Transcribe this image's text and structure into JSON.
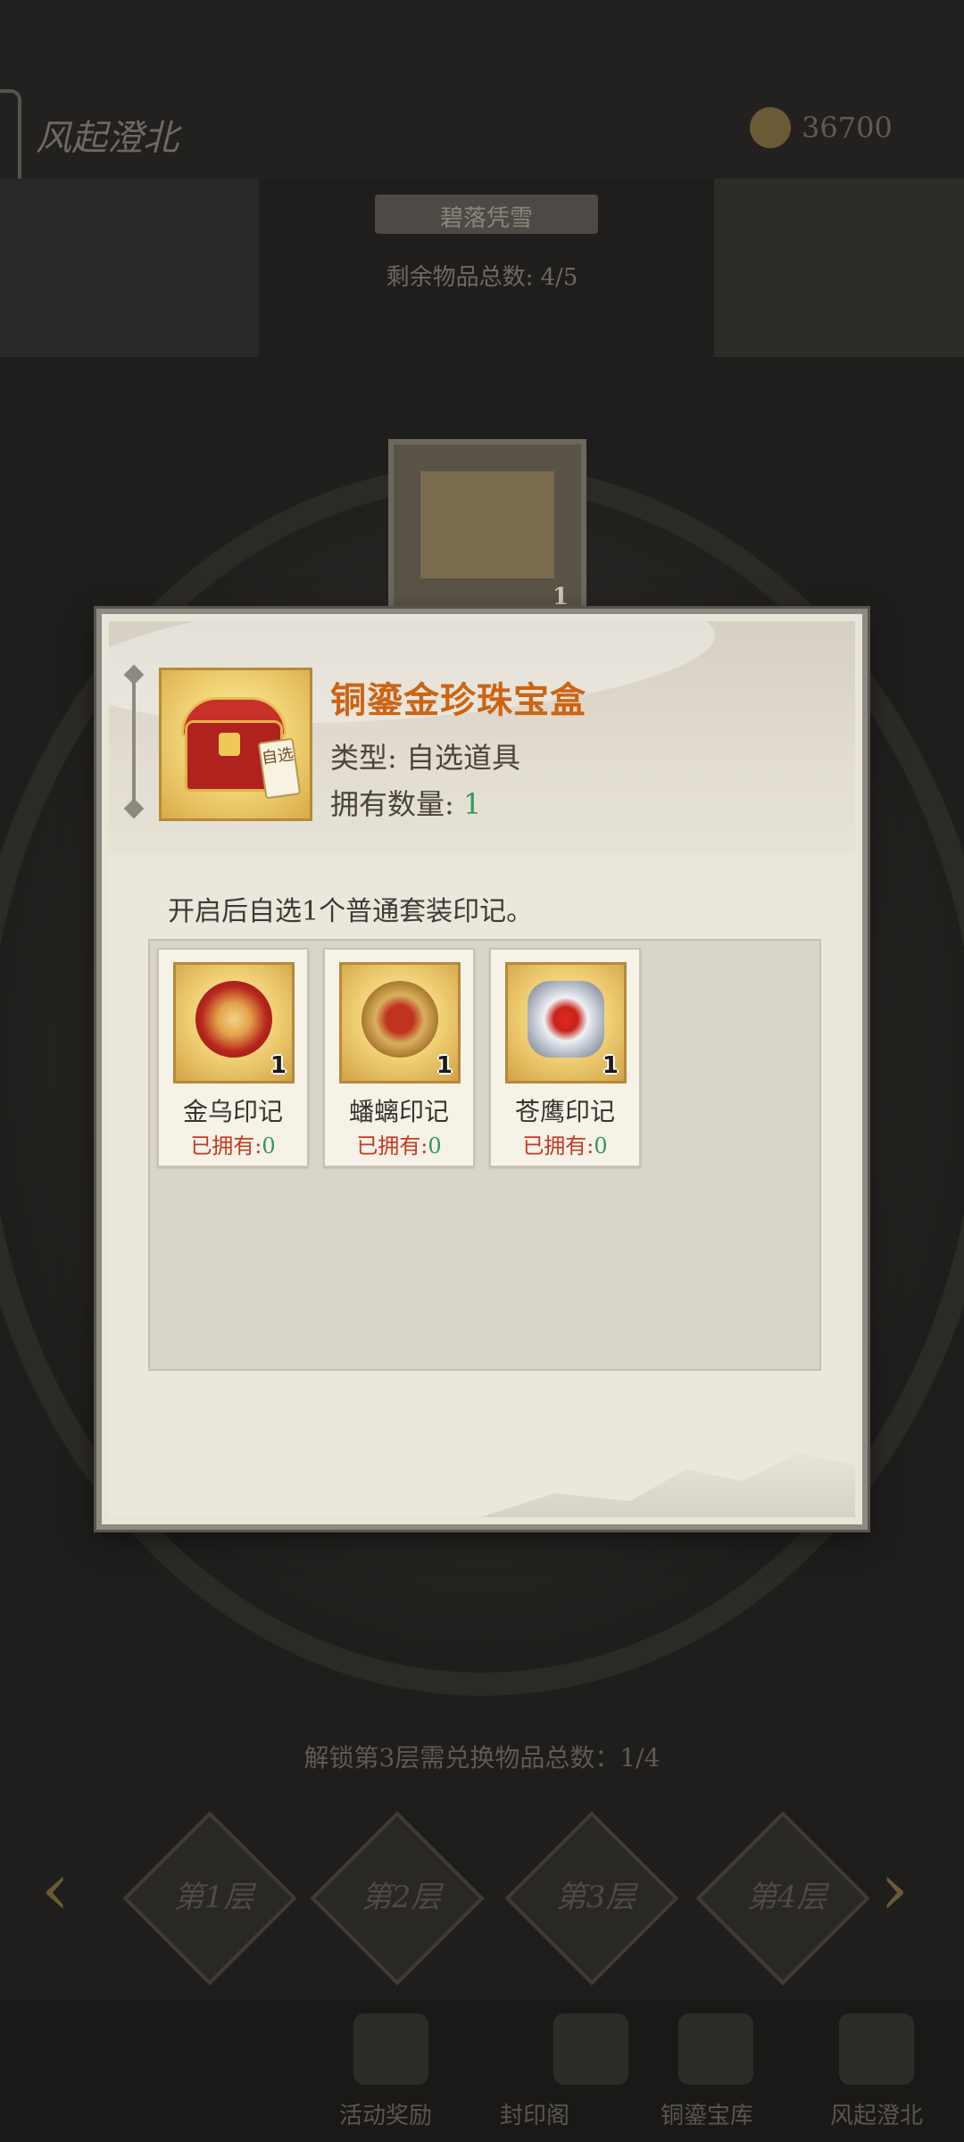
{
  "background": {
    "title": "风起澄北",
    "currency_value": "36700",
    "banner": "碧落凭雪",
    "remaining_items": "剩余物品总数: 4/5",
    "preview_item_count": "1",
    "unlock_text": "解锁第3层需兑换物品总数：1/4",
    "floors": [
      "第1层",
      "第2层",
      "第3层",
      "第4层"
    ],
    "nav_left_arrow": "‹",
    "nav_right_arrow": "›",
    "bottom_nav": [
      "活动奖励",
      "封印阁",
      "铜鎏宝库",
      "风起澄北"
    ]
  },
  "modal": {
    "item": {
      "name": "铜鎏金珍珠宝盒",
      "type_label": "类型: 自选道具",
      "owned_label": "拥有数量:",
      "owned_value": "1",
      "tag_text": "自选"
    },
    "description": "开启后自选1个普通套装印记。",
    "options": [
      {
        "name": "金乌印记",
        "count": "1",
        "owned_label": "已拥有:",
        "owned_value": "0",
        "icon": "golden-crow-seal-icon"
      },
      {
        "name": "蟠螭印记",
        "count": "1",
        "owned_label": "已拥有:",
        "owned_value": "0",
        "icon": "panchi-dragon-seal-icon"
      },
      {
        "name": "苍鹰印记",
        "count": "1",
        "owned_label": "已拥有:",
        "owned_value": "0",
        "icon": "goshawk-seal-icon"
      }
    ]
  },
  "colors": {
    "item_name": "#cc6412",
    "owned_value": "#2f9a5a",
    "owned_label": "#c23a22"
  }
}
